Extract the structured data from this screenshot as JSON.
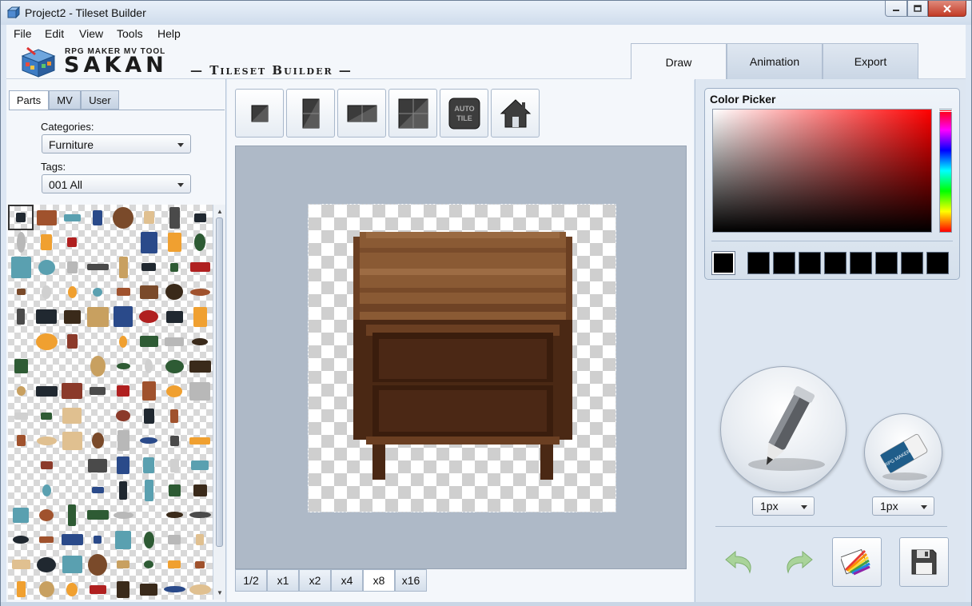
{
  "window": {
    "title": "Project2 - Tileset Builder"
  },
  "menu": [
    "File",
    "Edit",
    "View",
    "Tools",
    "Help"
  ],
  "header": {
    "logo_small": "RPG MAKER MV TOOL",
    "logo_big": "SAKAN",
    "logo_sub": "— Tileset Builder —",
    "tabs": [
      {
        "label": "Draw",
        "active": true
      },
      {
        "label": "Animation",
        "active": false
      },
      {
        "label": "Export",
        "active": false
      }
    ]
  },
  "left": {
    "subtabs": [
      {
        "label": "Parts",
        "active": true
      },
      {
        "label": "MV",
        "active": false
      },
      {
        "label": "User",
        "active": false
      }
    ],
    "categories_label": "Categories:",
    "categories_value": "Furniture",
    "tags_label": "Tags:",
    "tags_value": "001 All"
  },
  "center": {
    "tools": [
      {
        "icon": "single-tile-icon"
      },
      {
        "icon": "vertical-two-tile-icon"
      },
      {
        "icon": "horizontal-two-tile-icon"
      },
      {
        "icon": "four-tile-icon"
      },
      {
        "icon": "auto-tile-icon",
        "label": "AUTO TILE"
      },
      {
        "icon": "house-icon"
      }
    ],
    "zoom": [
      {
        "label": "1/2",
        "active": false
      },
      {
        "label": "x1",
        "active": false
      },
      {
        "label": "x2",
        "active": false
      },
      {
        "label": "x4",
        "active": false
      },
      {
        "label": "x8",
        "active": true
      },
      {
        "label": "x16",
        "active": false
      }
    ]
  },
  "right": {
    "color_picker_title": "Color Picker",
    "current_color": "#000000",
    "palette": [
      "#000000",
      "#000000",
      "#000000",
      "#000000",
      "#000000",
      "#000000",
      "#000000",
      "#000000"
    ],
    "pencil_size": "1px",
    "eraser_size": "1px",
    "eraser_brand": "RPG MAKER"
  },
  "colors": {
    "accent": "#dde7f3",
    "wood": "#7a4a2a"
  }
}
